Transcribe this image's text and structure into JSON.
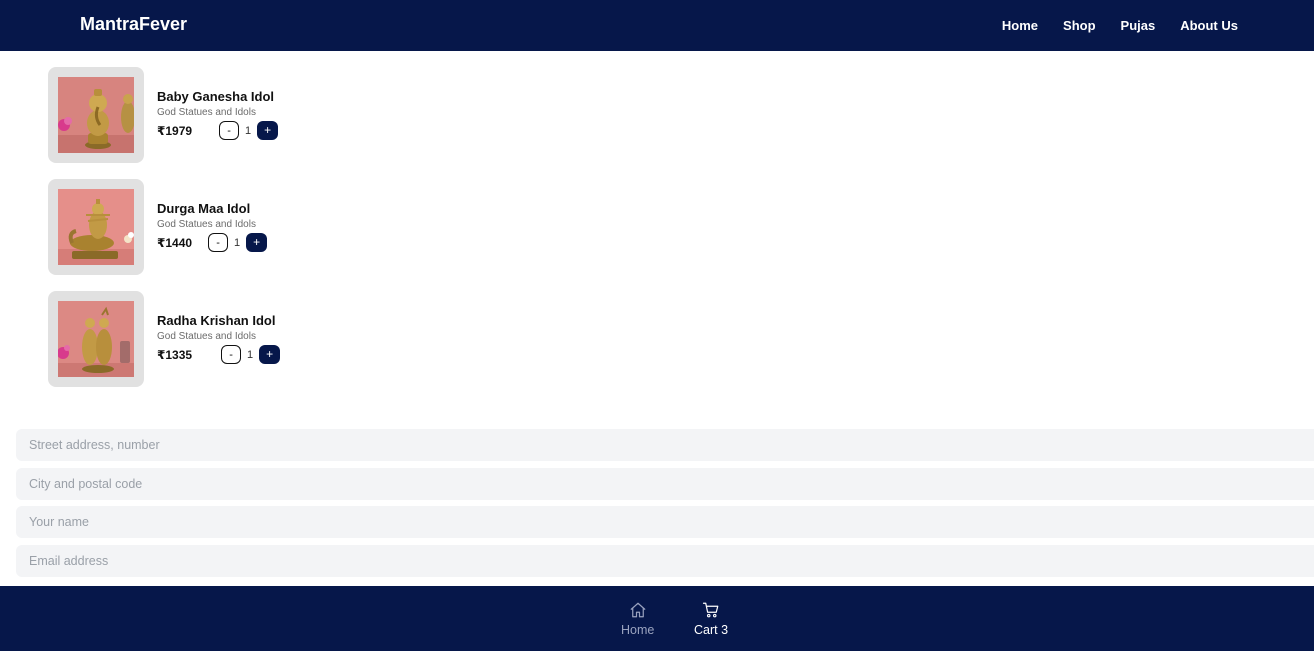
{
  "app": {
    "brand": "MantraFever"
  },
  "nav": {
    "links": [
      {
        "label": "Home"
      },
      {
        "label": "Shop"
      },
      {
        "label": "Pujas"
      },
      {
        "label": "About Us"
      }
    ]
  },
  "cart": {
    "items": [
      {
        "title": "Baby Ganesha Idol",
        "category": "God Statues and Idols",
        "price": "₹1979",
        "qty": "1",
        "minus": "-",
        "plus": "+",
        "image": "ganesha-idol-image"
      },
      {
        "title": "Durga Maa Idol",
        "category": "God Statues and Idols",
        "price": "₹1440",
        "qty": "1",
        "minus": "-",
        "plus": "+",
        "image": "durga-idol-image"
      },
      {
        "title": "Radha Krishan Idol",
        "category": "God Statues and Idols",
        "price": "₹1335",
        "qty": "1",
        "minus": "-",
        "plus": "+",
        "image": "radha-krishan-idol-image"
      }
    ]
  },
  "form": {
    "street": {
      "placeholder": "Street address, number",
      "value": ""
    },
    "city": {
      "placeholder": "City and postal code",
      "value": ""
    },
    "name": {
      "placeholder": "Your name",
      "value": ""
    },
    "email": {
      "placeholder": "Email address",
      "value": ""
    }
  },
  "bottom_nav": {
    "home": {
      "label": "Home",
      "icon": "home-icon"
    },
    "cart": {
      "label": "Cart 3",
      "icon": "cart-icon"
    }
  },
  "colors": {
    "navy": "#06174a",
    "thumb_bg": "#e1e1e1",
    "field_bg": "#f3f4f6",
    "photo_bg": "#d97f7a",
    "gold": "#b8913a"
  }
}
